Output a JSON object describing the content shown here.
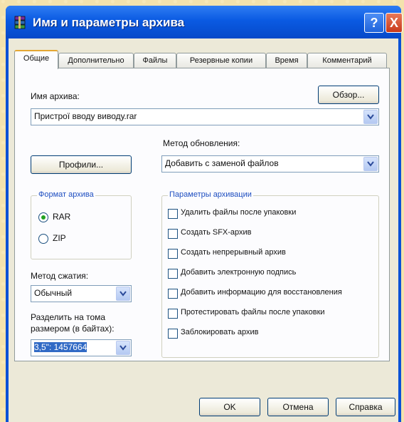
{
  "window": {
    "title": "Имя и параметры архива",
    "help_glyph": "?",
    "close_glyph": "X"
  },
  "tabs": [
    {
      "label": "Общие",
      "active": true
    },
    {
      "label": "Дополнительно"
    },
    {
      "label": "Файлы"
    },
    {
      "label": "Резервные копии"
    },
    {
      "label": "Время"
    },
    {
      "label": "Комментарий"
    }
  ],
  "archive_name": {
    "label": "Имя архива:",
    "browse_label": "Обзор...",
    "value": "Пристрої вводу виводу.rar"
  },
  "update_method": {
    "label": "Метод обновления:",
    "value": "Добавить с заменой файлов"
  },
  "profiles_label": "Профили...",
  "format": {
    "title": "Формат архива",
    "options": [
      "RAR",
      "ZIP"
    ],
    "selected": "RAR"
  },
  "compression": {
    "label": "Метод сжатия:",
    "value": "Обычный"
  },
  "split": {
    "label_line1": "Разделить на тома",
    "label_line2": "размером (в байтах):",
    "value": "3,5\":   1457664"
  },
  "params": {
    "title": "Параметры архивации",
    "options": [
      "Удалить файлы после упаковки",
      "Создать SFX-архив",
      "Создать непрерывный архив",
      "Добавить электронную подпись",
      "Добавить информацию для восстановления",
      "Протестировать файлы после упаковки",
      "Заблокировать архив"
    ]
  },
  "buttons": {
    "ok": "OK",
    "cancel": "Отмена",
    "help": "Справка"
  },
  "colors": {
    "titlebar": "#0a5ae2",
    "dialog_bg": "#ece9d8",
    "group_title": "#1f4fc1",
    "radio_dot": "#21a121"
  }
}
